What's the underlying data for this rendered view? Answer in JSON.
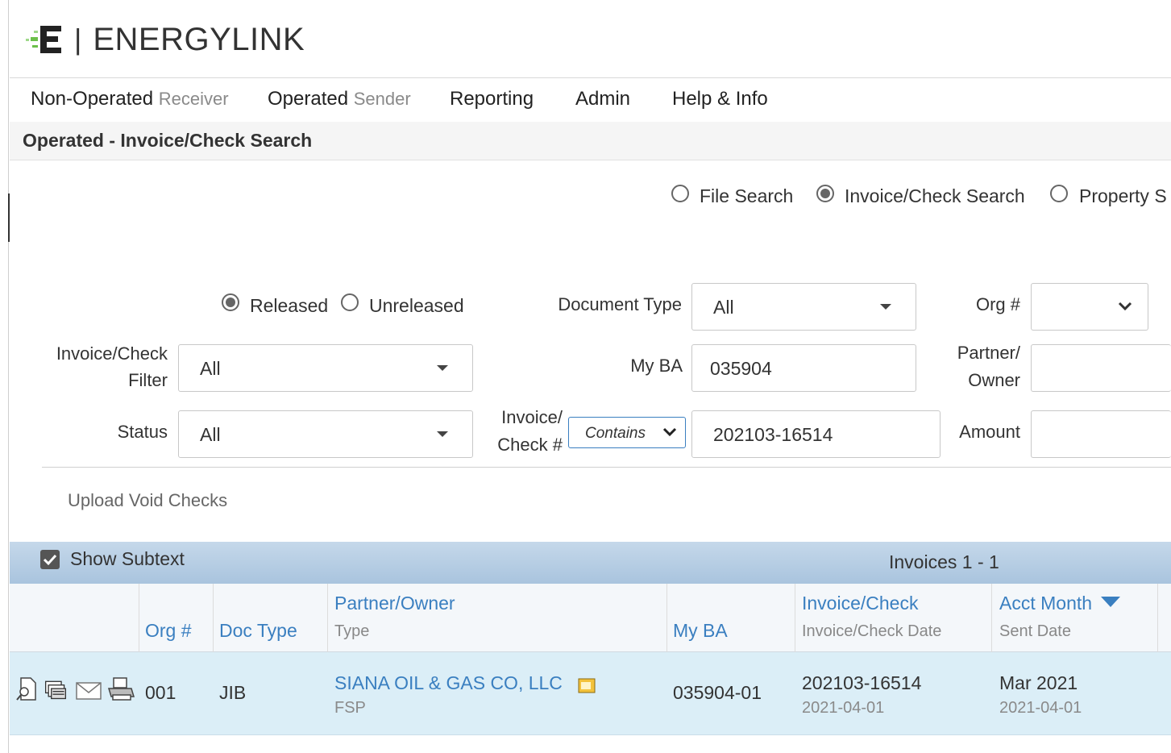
{
  "brand": {
    "separator": "|",
    "name": "ENERGYLINK"
  },
  "nav": {
    "non_operated": "Non-Operated",
    "non_operated_sub": "Receiver",
    "operated": "Operated",
    "operated_sub": "Sender",
    "reporting": "Reporting",
    "admin": "Admin",
    "help": "Help & Info"
  },
  "breadcrumb": "Operated - Invoice/Check Search",
  "search_modes": {
    "file": "File Search",
    "invoice": "Invoice/Check Search",
    "property": "Property S",
    "selected": "invoice"
  },
  "release": {
    "released": "Released",
    "unreleased": "Unreleased",
    "selected": "released"
  },
  "filters": {
    "document_type_label": "Document Type",
    "document_type_value": "All",
    "org_label": "Org #",
    "org_value": "",
    "invoice_filter_label_1": "Invoice/Check",
    "invoice_filter_label_2": "Filter",
    "invoice_filter_value": "All",
    "my_ba_label": "My BA",
    "my_ba_value": "035904",
    "partner_label_1": "Partner/",
    "partner_label_2": "Owner",
    "partner_value": "",
    "status_label": "Status",
    "status_value": "All",
    "invoice_no_label_1": "Invoice/",
    "invoice_no_label_2": "Check #",
    "match_mode": "Contains",
    "invoice_no_value": "202103-16514",
    "amount_label": "Amount",
    "amount_value": ""
  },
  "upload_void": "Upload Void Checks",
  "grid": {
    "show_subtext": "Show Subtext",
    "count": "Invoices 1 - 1",
    "headers": {
      "org": "Org #",
      "doc_type": "Doc Type",
      "partner": "Partner/Owner",
      "partner_sub": "Type",
      "my_ba": "My BA",
      "invoice": "Invoice/Check",
      "invoice_sub": "Invoice/Check Date",
      "acct_month": "Acct Month",
      "acct_month_sub": "Sent Date"
    },
    "rows": [
      {
        "org": "001",
        "doc_type": "JIB",
        "partner": "SIANA OIL & GAS CO, LLC",
        "partner_type": "FSP",
        "my_ba": "035904-01",
        "invoice": "202103-16514",
        "invoice_date": "2021-04-01",
        "acct_month": "Mar 2021",
        "sent_date": "2021-04-01"
      }
    ]
  },
  "colors": {
    "accent_blue": "#3a7fc0",
    "logo_green": "#6cc04a",
    "row_bg": "#dbeef7"
  }
}
